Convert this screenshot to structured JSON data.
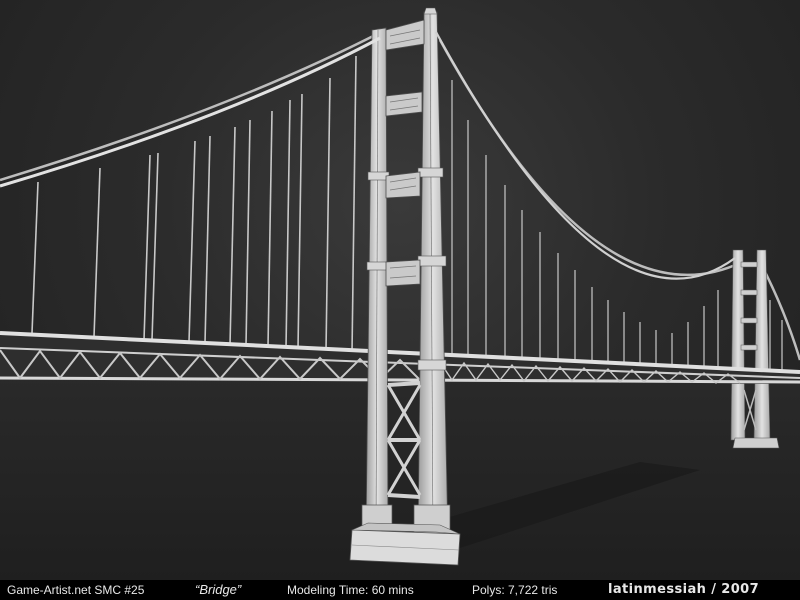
{
  "footer": {
    "site": "Game-Artist.net SMC #25",
    "title": "“Bridge”",
    "modeling_time": "Modeling Time:  60 mins",
    "polys": "Polys:  7,722  tris",
    "author": "latinmessiah / 2007"
  },
  "colors": {
    "background": "#2b2b2b",
    "model": "#d8d8d8",
    "wire": "#555555",
    "footer_bg": "#000000",
    "footer_text": "#e8e8e8"
  }
}
